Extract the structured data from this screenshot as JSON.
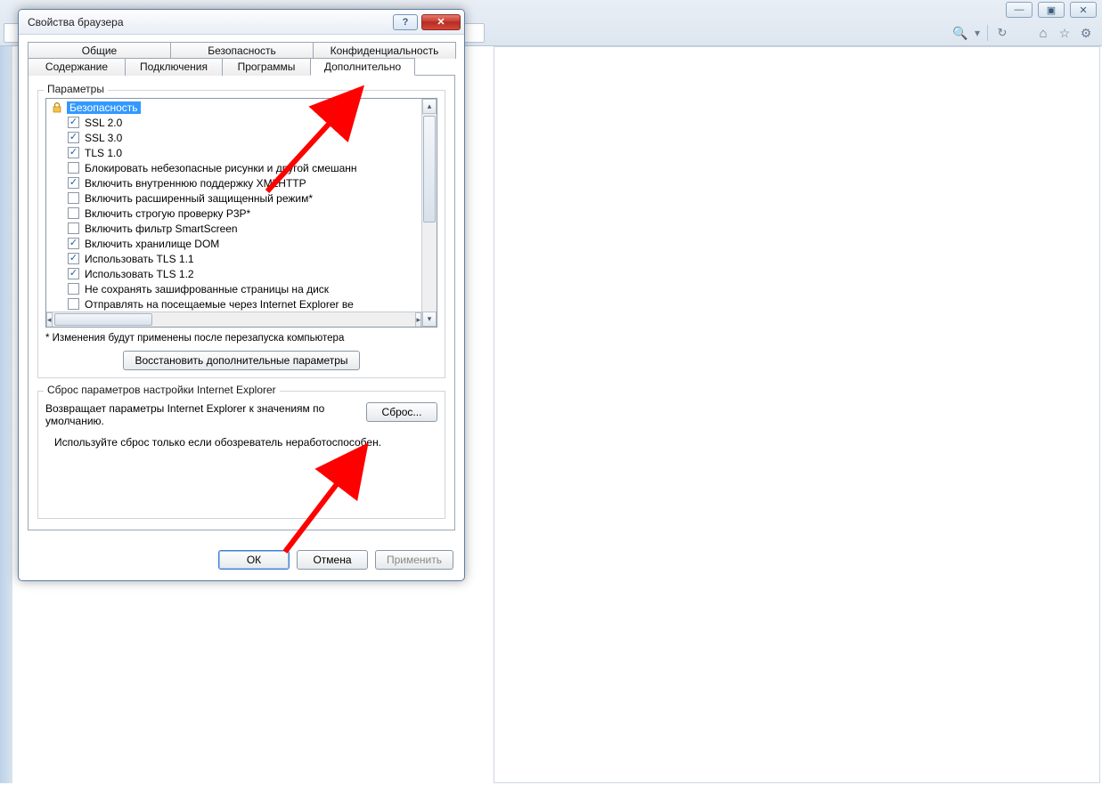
{
  "windowControls": {
    "min": "—",
    "max": "▣",
    "close": "✕"
  },
  "toolbar": {
    "search": "🔍",
    "dropdown": "▾",
    "refresh": "↻",
    "home": "⌂",
    "star": "☆",
    "gear": "⚙"
  },
  "dialog": {
    "title": "Свойства браузера",
    "helpGlyph": "?",
    "closeGlyph": "✕",
    "tabsRow1": [
      "Общие",
      "Безопасность",
      "Конфиденциальность"
    ],
    "tabsRow2": [
      "Содержание",
      "Подключения",
      "Программы",
      "Дополнительно"
    ],
    "activeTab": "Дополнительно",
    "params": {
      "groupLabel": "Параметры",
      "categoryLabel": "Безопасность",
      "items": [
        {
          "label": "SSL 2.0",
          "checked": true
        },
        {
          "label": "SSL 3.0",
          "checked": true
        },
        {
          "label": "TLS 1.0",
          "checked": true
        },
        {
          "label": "Блокировать небезопасные рисунки и другой смешанн",
          "checked": false
        },
        {
          "label": "Включить внутреннюю поддержку XMLHTTP",
          "checked": true
        },
        {
          "label": "Включить расширенный защищенный режим*",
          "checked": false
        },
        {
          "label": "Включить строгую проверку P3P*",
          "checked": false
        },
        {
          "label": "Включить фильтр SmartScreen",
          "checked": false
        },
        {
          "label": "Включить хранилище DOM",
          "checked": true
        },
        {
          "label": "Использовать TLS 1.1",
          "checked": true
        },
        {
          "label": "Использовать TLS 1.2",
          "checked": true
        },
        {
          "label": "Не сохранять зашифрованные страницы на диск",
          "checked": false
        },
        {
          "label": "Отправлять на посещаемые через Internet Explorer ве",
          "checked": false
        }
      ],
      "note": "* Изменения будут применены после перезапуска компьютера",
      "restoreButton": "Восстановить дополнительные параметры"
    },
    "reset": {
      "groupLabel": "Сброс параметров настройки Internet Explorer",
      "text": "Возвращает параметры Internet Explorer к значениям по умолчанию.",
      "button": "Сброс...",
      "note": "Используйте сброс только если обозреватель неработоспособен."
    },
    "footer": {
      "ok": "ОК",
      "cancel": "Отмена",
      "apply": "Применить"
    }
  }
}
